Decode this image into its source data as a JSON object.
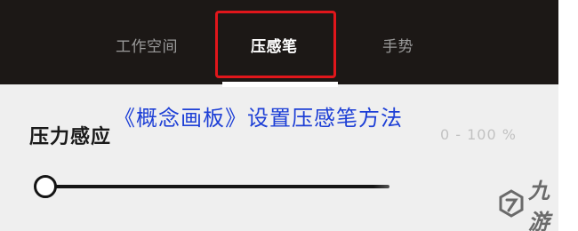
{
  "tabs": [
    {
      "label": "工作空间",
      "active": false
    },
    {
      "label": "压感笔",
      "active": true
    },
    {
      "label": "手势",
      "active": false
    }
  ],
  "caption": "《概念画板》设置压感笔方法",
  "setting": {
    "label": "压力感应",
    "range": "0 - 100 %",
    "value_fraction": 0.0
  },
  "watermark": {
    "brand": "九游",
    "icon": "jiuyou-logo-icon"
  },
  "colors": {
    "tabbar_bg": "#1c1816",
    "highlight": "#e0161b",
    "caption": "#1d3fd6"
  }
}
